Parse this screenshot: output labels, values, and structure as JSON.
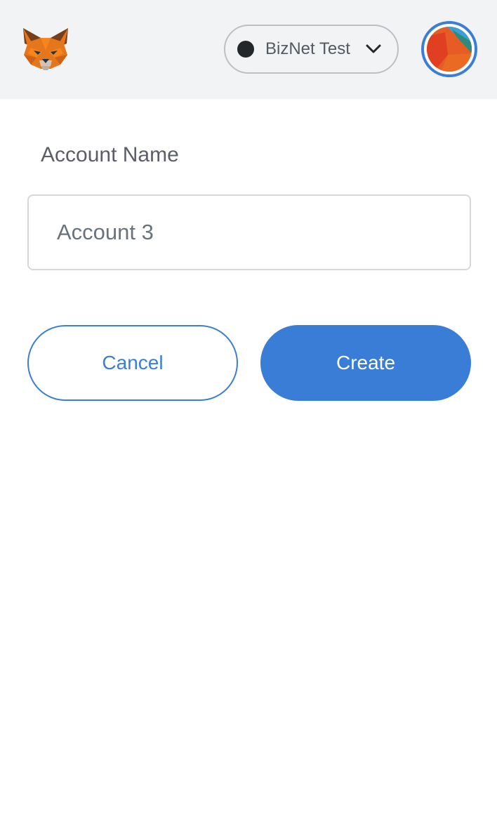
{
  "header": {
    "logo_icon": "metamask-fox-icon",
    "network": {
      "name": "BizNet Test",
      "dot_color": "#24272a",
      "icon": "chevron-down-icon"
    },
    "avatar_icon": "account-identicon"
  },
  "form": {
    "label": "Account Name",
    "input": {
      "value": "",
      "placeholder": "Account 3"
    }
  },
  "actions": {
    "cancel_label": "Cancel",
    "create_label": "Create"
  },
  "colors": {
    "accent": "#3a7dd6",
    "header_bg": "#f2f3f4"
  }
}
